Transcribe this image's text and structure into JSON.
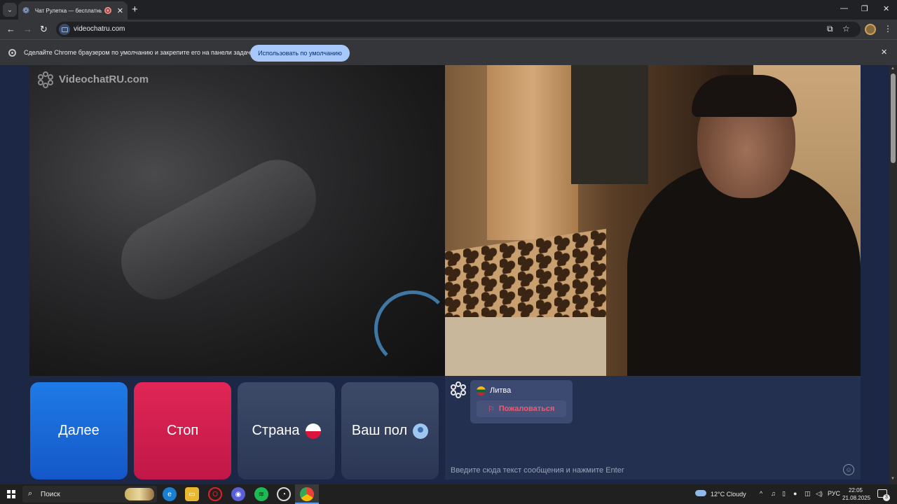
{
  "browser": {
    "tab": {
      "title": "Чат Рулетка — бесплатный видеочат"
    },
    "url": "videochatru.com",
    "infobar": {
      "text": "Сделайте Chrome браузером по умолчанию и закрепите его на панели задач.",
      "button": "Использовать по умолчанию"
    }
  },
  "site": {
    "logo_text": "VideochatRU.com",
    "buttons": {
      "next": "Далее",
      "stop": "Стоп",
      "country": "Страна",
      "gender": "Ваш пол"
    },
    "chat": {
      "partner_country": "Литва",
      "report": "Пожаловаться",
      "input_placeholder": "Введите сюда текст сообщения и нажмите Enter"
    }
  },
  "taskbar": {
    "search": "Поиск",
    "weather": "12°C  Cloudy",
    "lang": "РУС",
    "time": "22:05",
    "date": "21.08.2025",
    "notifications": "3"
  }
}
